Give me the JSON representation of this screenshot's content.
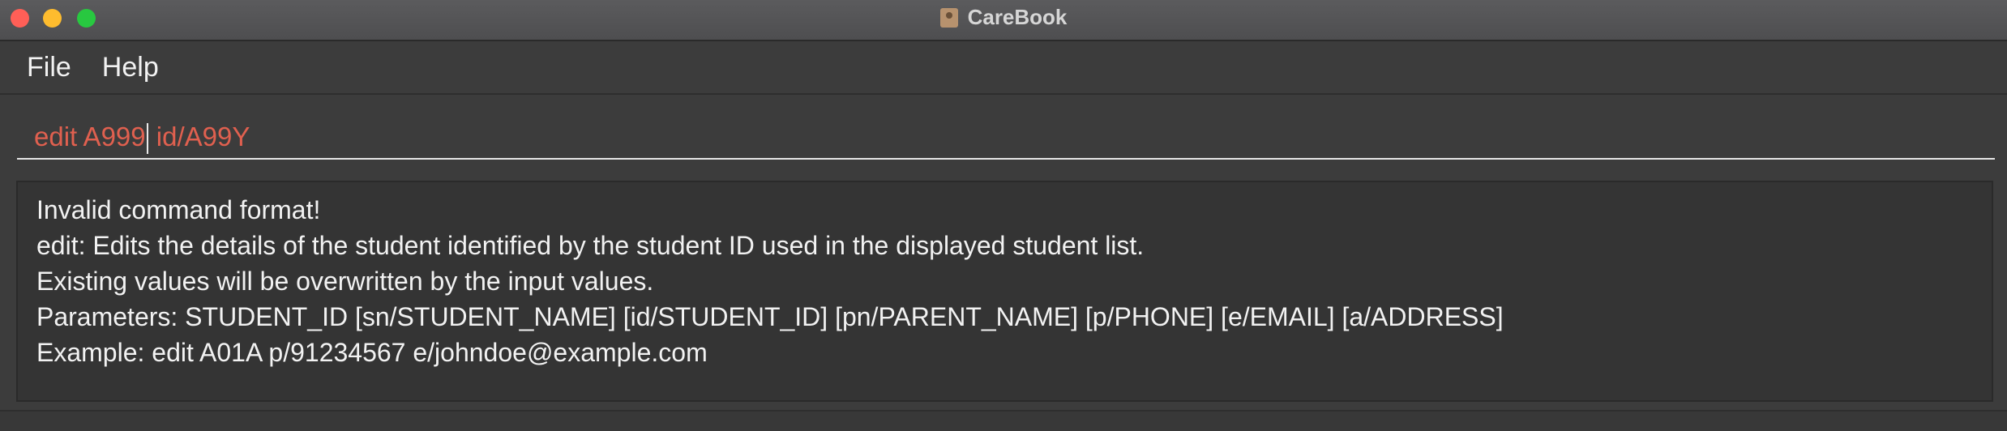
{
  "window": {
    "title": "CareBook",
    "app_icon": "contact-book-icon",
    "controls": [
      "close",
      "minimize",
      "maximize"
    ],
    "colors": {
      "close": "#ff5f57",
      "minimize": "#febc2e",
      "maximize": "#28c840"
    }
  },
  "menu": {
    "items": [
      {
        "label": "File"
      },
      {
        "label": "Help"
      }
    ]
  },
  "command": {
    "before_cursor": "edit A999",
    "after_cursor": " id/A99Y",
    "text_color": "#e0604f"
  },
  "result": {
    "lines": [
      "Invalid command format!",
      "edit: Edits the details of the student identified by the student ID used in the displayed student list.",
      "Existing values will be overwritten by the input values.",
      "Parameters: STUDENT_ID [sn/STUDENT_NAME] [id/STUDENT_ID] [pn/PARENT_NAME] [p/PHONE] [e/EMAIL] [a/ADDRESS]",
      "Example: edit A01A p/91234567 e/johndoe@example.com"
    ]
  }
}
